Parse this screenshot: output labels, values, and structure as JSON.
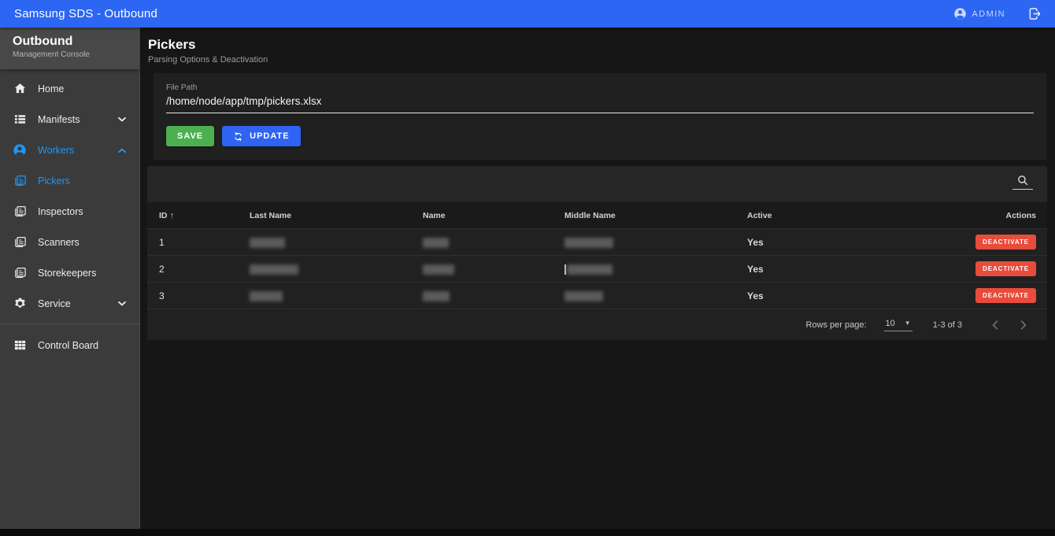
{
  "topbar": {
    "title": "Samsung SDS - Outbound",
    "user_label": "ADMIN",
    "user_icon": "account-circle-icon",
    "logout_icon": "logout-icon"
  },
  "sidebar": {
    "title": "Outbound",
    "subtitle": "Management Console",
    "items": [
      {
        "label": "Home",
        "icon": "home-icon"
      },
      {
        "label": "Manifests",
        "icon": "list-icon",
        "chevron": "down"
      },
      {
        "label": "Workers",
        "icon": "account-circle-icon",
        "chevron": "up",
        "active": true
      },
      {
        "label": "Pickers",
        "icon": "badge-card-icon",
        "active": true
      },
      {
        "label": "Inspectors",
        "icon": "badge-card-icon"
      },
      {
        "label": "Scanners",
        "icon": "badge-card-icon"
      },
      {
        "label": "Storekeepers",
        "icon": "badge-card-icon"
      },
      {
        "label": "Service",
        "icon": "gear-icon",
        "chevron": "down"
      },
      {
        "label": "Control Board",
        "icon": "grid-icon",
        "divider_before": true
      }
    ]
  },
  "page": {
    "title": "Pickers",
    "subtitle": "Parsing Options & Deactivation"
  },
  "file_form": {
    "label": "File Path",
    "value": "/home/node/app/tmp/pickers.xlsx",
    "save_label": "SAVE",
    "update_label": "UPDATE",
    "update_icon": "sync-icon"
  },
  "table": {
    "search_icon": "search-icon",
    "columns": {
      "id": "ID",
      "last_name": "Last Name",
      "name": "Name",
      "middle_name": "Middle Name",
      "active": "Active",
      "actions": "Actions"
    },
    "sort": {
      "column": "ID",
      "direction": "asc",
      "arrow": "↑"
    },
    "rows": [
      {
        "id": "1",
        "active": "Yes",
        "action_label": "DEACTIVATE",
        "redacted_widths": {
          "last": 45,
          "name": 33,
          "middle": 62
        }
      },
      {
        "id": "2",
        "active": "Yes",
        "action_label": "DEACTIVATE",
        "redacted_widths": {
          "last": 62,
          "name": 40,
          "middle": 58
        }
      },
      {
        "id": "3",
        "active": "Yes",
        "action_label": "DEACTIVATE",
        "redacted_widths": {
          "last": 42,
          "name": 34,
          "middle": 49
        }
      }
    ],
    "pagination": {
      "rows_per_page_label": "Rows per page:",
      "rows_per_page_value": "10",
      "range_label": "1-3 of 3"
    }
  },
  "colors": {
    "topbar_blue": "#2c66f2",
    "active_blue": "#2196f3",
    "save_green": "#4caf50",
    "update_blue": "#2f63f2",
    "deactivate_red": "#e74c3c",
    "sidebar_gray": "#3b3b3b",
    "card_gray": "#202020"
  }
}
